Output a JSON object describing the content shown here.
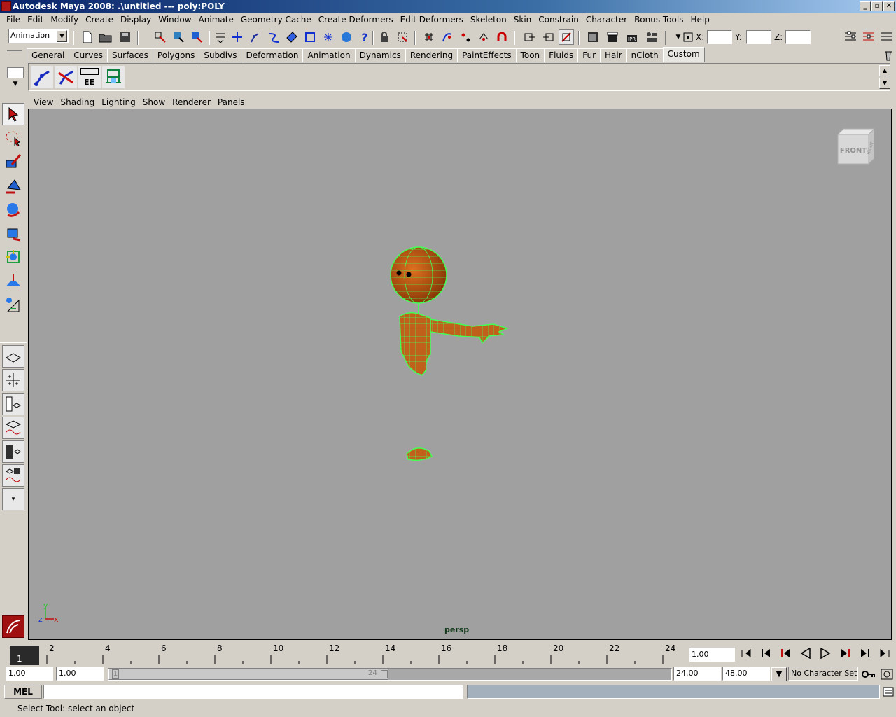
{
  "window": {
    "title": "Autodesk Maya 2008: .\\untitled   ---   poly:POLY",
    "minimize": "_",
    "maximize": "▫",
    "close": "✕"
  },
  "menus": [
    "File",
    "Edit",
    "Modify",
    "Create",
    "Display",
    "Window",
    "Animate",
    "Geometry Cache",
    "Create Deformers",
    "Edit Deformers",
    "Skeleton",
    "Skin",
    "Constrain",
    "Character",
    "Bonus Tools",
    "Help"
  ],
  "statusline": {
    "menuset": "Animation",
    "x_label": "X:",
    "y_label": "Y:",
    "z_label": "Z:",
    "x_value": "",
    "y_value": "",
    "z_value": ""
  },
  "shelf": {
    "tabs": [
      "General",
      "Curves",
      "Surfaces",
      "Polygons",
      "Subdivs",
      "Deformation",
      "Animation",
      "Dynamics",
      "Rendering",
      "PaintEffects",
      "Toon",
      "Fluids",
      "Fur",
      "Hair",
      "nCloth",
      "Custom"
    ],
    "active_tab": "Custom",
    "buttons": [
      "ik-joint-icon",
      "ik-handle-icon",
      "EE",
      "render-icon"
    ],
    "ee_label": "EE"
  },
  "panel": {
    "menus": [
      "View",
      "Shading",
      "Lighting",
      "Show",
      "Renderer",
      "Panels"
    ],
    "camera_name": "persp",
    "viewcube_label": "FRONT",
    "viewcube_side": "RIGHT",
    "axis_y": "y",
    "axis_z": "z",
    "axis_x": "x"
  },
  "timeline": {
    "current_frame": "1",
    "ticks": [
      "2",
      "4",
      "6",
      "8",
      "10",
      "12",
      "14",
      "16",
      "18",
      "20",
      "22",
      "24"
    ],
    "current_time": "1.00"
  },
  "range": {
    "start": "1.00",
    "playback_start": "1.00",
    "slider_start": "1",
    "slider_end": "24",
    "playback_end": "24.00",
    "end": "48.00",
    "character_set": "No Character Set"
  },
  "command": {
    "language": "MEL",
    "input": ""
  },
  "help": {
    "text": "Select Tool: select an object"
  },
  "colors": {
    "viewport_bg": "#a0a0a0",
    "mesh_fill": "#c0601a",
    "wire": "#44ff55"
  }
}
